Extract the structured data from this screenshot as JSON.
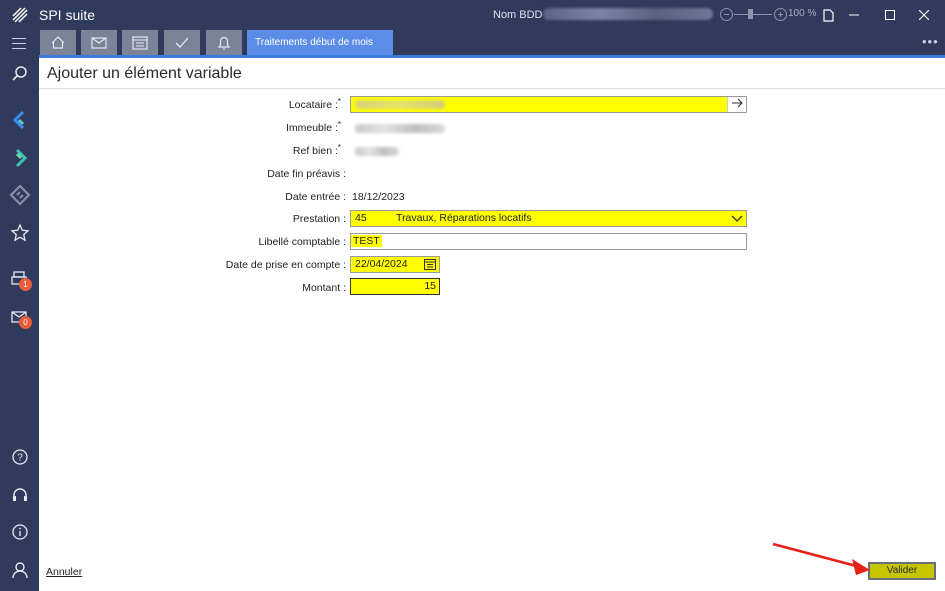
{
  "titlebar": {
    "app_title": "SPI suite",
    "db_label": "Nom BDD :",
    "zoom_percent": "100 %"
  },
  "tabs": {
    "icon_tabs": [
      "home-icon",
      "mail-icon",
      "calendar-icon",
      "check-icon",
      "bell-icon"
    ],
    "active_label": "Traitements début de mois"
  },
  "sidebar": {
    "top_icons": [
      "search-icon",
      "chevron-left-icon",
      "chevron-right-icon",
      "diamond-icon",
      "star-icon",
      "printer-icon",
      "mail-icon"
    ],
    "printer_badge": "1",
    "mail_badge": "0",
    "bottom_icons": [
      "help-icon",
      "headset-icon",
      "info-icon",
      "user-icon"
    ]
  },
  "form": {
    "title": "Ajouter un élément variable",
    "locataire_label": "Locataire :",
    "immeuble_label": "Immeuble :",
    "ref_bien_label": "Ref bien :",
    "date_fin_preavis_label": "Date fin préavis :",
    "date_entree_label": "Date entrée :",
    "date_entree_value": "18/12/2023",
    "prestation_label": "Prestation :",
    "prestation_code": "45",
    "prestation_text": "Travaux, Réparations locatifs",
    "libelle_label": "Libellé comptable :",
    "libelle_value": "TEST",
    "date_prise_label": "Date de prise en compte :",
    "date_prise_value": "22/04/2024",
    "montant_label": "Montant :",
    "montant_value": "15"
  },
  "footer": {
    "cancel_label": "Annuler",
    "validate_label": "Valider"
  },
  "colors": {
    "chrome": "#2f3a5c",
    "accent": "#3a7be0",
    "active_tab": "#5b8de8",
    "highlight": "#ffff00",
    "badge": "#ea5b3a",
    "annotation_arrow": "#e8201a"
  }
}
